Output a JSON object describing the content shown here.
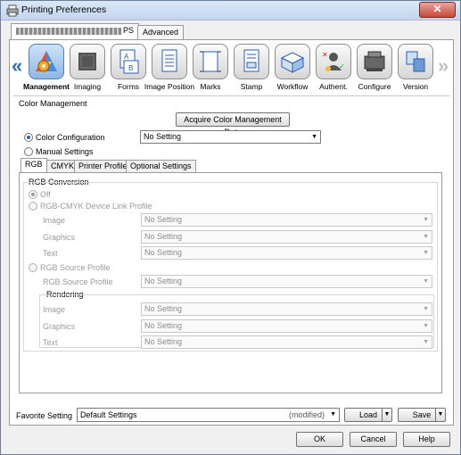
{
  "window": {
    "title": "Printing Preferences",
    "close_glyph": "✕"
  },
  "outer_tabs": [
    {
      "label": "PS",
      "active": true
    },
    {
      "label": "Advanced",
      "active": false
    }
  ],
  "iconbar": {
    "left_arrow": "«",
    "right_arrow": "»",
    "items": [
      {
        "label": "Management",
        "icon": "gear-palette-icon",
        "selected": true
      },
      {
        "label": "Imaging",
        "icon": "imaging-icon",
        "selected": false
      },
      {
        "label": "Forms",
        "icon": "forms-icon",
        "selected": false
      },
      {
        "label": "Image Position",
        "icon": "image-position-icon",
        "selected": false
      },
      {
        "label": "Marks",
        "icon": "marks-icon",
        "selected": false
      },
      {
        "label": "Stamp",
        "icon": "stamp-icon",
        "selected": false
      },
      {
        "label": "Workflow",
        "icon": "workflow-icon",
        "selected": false
      },
      {
        "label": "Authent.",
        "icon": "authentication-icon",
        "selected": false
      },
      {
        "label": "Configure",
        "icon": "configure-icon",
        "selected": false
      },
      {
        "label": "Version",
        "icon": "version-icon",
        "selected": false
      }
    ]
  },
  "color_management": {
    "group_label": "Color Management",
    "acquire_button": "Acquire Color Management Data",
    "color_config_label": "Color Configuration",
    "color_config_value": "No Setting",
    "manual_settings_label": "Manual Settings"
  },
  "inner_tabs": [
    {
      "label": "RGB",
      "active": true
    },
    {
      "label": "CMYK",
      "active": false
    },
    {
      "label": "Printer Profile",
      "active": false
    },
    {
      "label": "Optional Settings",
      "active": false
    }
  ],
  "rgb": {
    "group_label": "RGB Conversion",
    "off_label": "Off",
    "device_link_label": "RGB-CMYK Device Link Profile",
    "image_label": "Image",
    "graphics_label": "Graphics",
    "text_label": "Text",
    "source_profile_radio": "RGB Source Profile",
    "source_profile_label": "RGB Source Profile",
    "rendering_label": "Rendering",
    "no_setting": "No Setting"
  },
  "favorite": {
    "label": "Favorite Setting",
    "value": "Default Settings",
    "modified": "(modified)",
    "load": "Load",
    "save": "Save"
  },
  "dialog_buttons": {
    "ok": "OK",
    "cancel": "Cancel",
    "help": "Help"
  },
  "colors": {
    "accent": "#2a6fc4",
    "close": "#c74a3a"
  }
}
